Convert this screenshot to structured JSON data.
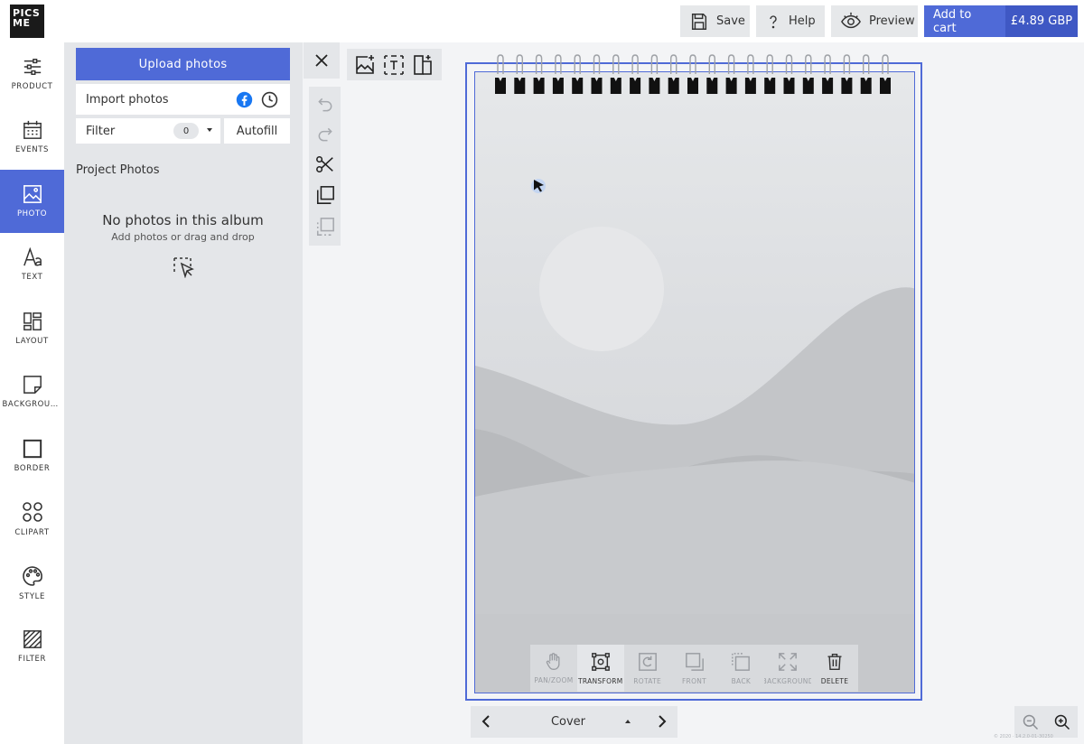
{
  "logo": {
    "line1": "PICS",
    "line2": "ME"
  },
  "toolbar": {
    "save_label": "Save",
    "help_label": "Help",
    "preview_label": "Preview",
    "add_to_cart_label": "Add to cart",
    "price": "£4.89 GBP"
  },
  "sidebar": {
    "items": [
      {
        "label": "PRODUCT",
        "icon": "sliders-icon"
      },
      {
        "label": "EVENTS",
        "icon": "calendar-icon"
      },
      {
        "label": "PHOTO",
        "icon": "image-icon",
        "active": true
      },
      {
        "label": "TEXT",
        "icon": "text-icon"
      },
      {
        "label": "LAYOUT",
        "icon": "layout-icon"
      },
      {
        "label": "BACKGROUND",
        "icon": "sticky-note-icon"
      },
      {
        "label": "BORDER",
        "icon": "border-icon"
      },
      {
        "label": "CLIPART",
        "icon": "shapes-icon"
      },
      {
        "label": "STYLE",
        "icon": "palette-icon"
      },
      {
        "label": "FILTER",
        "icon": "hatch-icon"
      }
    ]
  },
  "photo_panel": {
    "upload_label": "Upload photos",
    "import_label": "Import photos",
    "filter_label": "Filter",
    "filter_count": "0",
    "autofill_label": "Autofill",
    "section_title": "Project Photos",
    "empty_title": "No photos in this album",
    "empty_subtitle": "Add photos or drag and drop"
  },
  "edit_toolbar": {
    "tools": [
      {
        "label": "PAN/ZOOM",
        "enabled": false
      },
      {
        "label": "TRANSFORM",
        "enabled": true
      },
      {
        "label": "ROTATE",
        "enabled": false
      },
      {
        "label": "FRONT",
        "enabled": false
      },
      {
        "label": "BACK",
        "enabled": false
      },
      {
        "label": "BACKGROUND",
        "enabled": false
      },
      {
        "label": "DELETE",
        "enabled": true
      }
    ]
  },
  "page_nav": {
    "current_page": "Cover"
  },
  "version": "© 2020 · 14.2.0-01-30250",
  "colors": {
    "accent": "#4f6ad7",
    "accent_dark": "#3f58c4",
    "panel": "#e4e6e9",
    "canvas_bg": "#f3f4f6"
  }
}
